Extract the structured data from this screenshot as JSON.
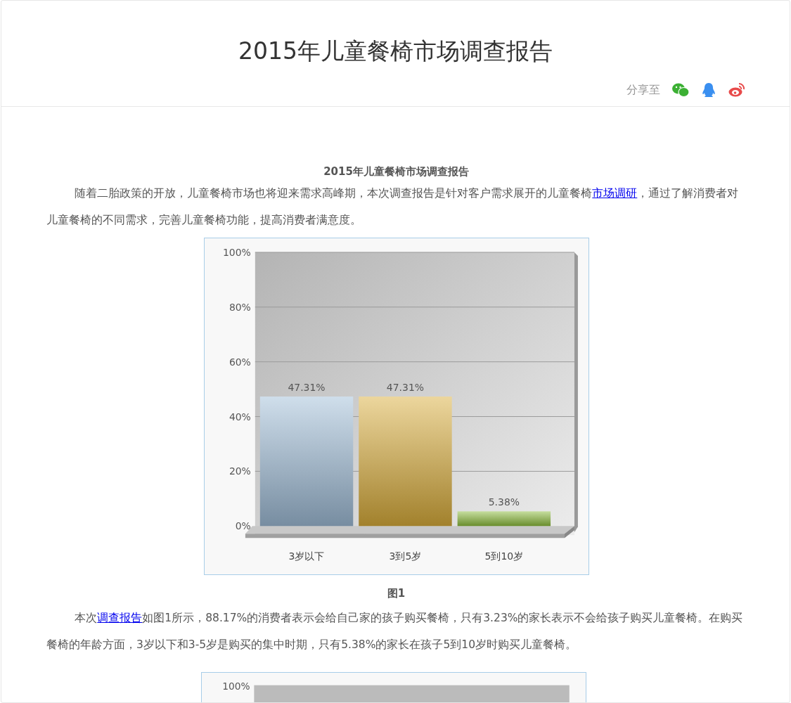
{
  "header": {
    "title": "2015年儿童餐椅市场调查报告",
    "share_label": "分享至"
  },
  "article": {
    "subtitle": "2015年儿童餐椅市场调查报告",
    "paragraph_1": [
      {
        "kind": "text",
        "text": "随着二胎政策的开放，儿童餐椅市场也将迎来需求高峰期，本次调查报告是针对客户需求展开的儿童餐椅"
      },
      {
        "kind": "link",
        "text": "市场调研"
      },
      {
        "kind": "text",
        "text": "，通过了解消费者对儿童餐椅的不同需求，完善儿童餐椅功能，提高消费者满意度。"
      }
    ],
    "figure_1": {
      "chart_data": {
        "type": "bar",
        "categories": [
          "3岁以下",
          "3到5岁",
          "5到10岁"
        ],
        "series": [
          {
            "values": [
              47.31,
              47.31,
              5.38
            ]
          }
        ],
        "ylim": [
          0,
          100
        ],
        "grid": true,
        "yticks": [
          {
            "value": 0,
            "label": "0%"
          },
          {
            "value": 20,
            "label": "20%"
          },
          {
            "value": 40,
            "label": "40%"
          },
          {
            "value": 60,
            "label": "60%"
          },
          {
            "value": 80,
            "label": "80%"
          },
          {
            "value": 100,
            "label": "100%"
          }
        ],
        "value_labels": [
          "47.31%",
          "47.31%",
          "5.38%"
        ]
      },
      "caption": "图1"
    },
    "paragraph_2": [
      {
        "kind": "text",
        "text": "本次"
      },
      {
        "kind": "link",
        "text": "调查报告"
      },
      {
        "kind": "text",
        "text": "如图1所示，88.17%的消费者表示会给自己家的孩子购买餐椅，只有3.23%的家长表示不会给孩子购买儿童餐椅。在购买餐椅的年龄方面，3岁以下和3-5岁是购买的集中时期，只有5.38%的家长在孩子5到10岁时购买儿童餐椅。"
      }
    ],
    "figure_2": {
      "top_tick_label": "100%"
    }
  }
}
